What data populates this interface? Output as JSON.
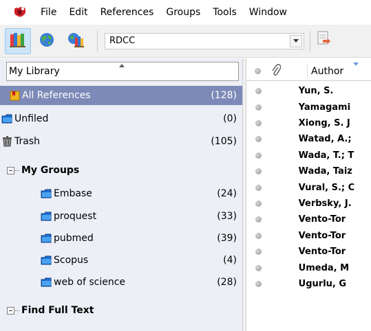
{
  "menubar": {
    "logo_icon": "endnote-logo-icon",
    "items": [
      "File",
      "Edit",
      "References",
      "Groups",
      "Tools",
      "Window"
    ]
  },
  "toolbar": {
    "mode_buttons": [
      {
        "icon": "local-library-mode-icon",
        "active": true
      },
      {
        "icon": "online-search-mode-icon",
        "active": false
      },
      {
        "icon": "integrated-library-mode-icon",
        "active": false
      }
    ],
    "output_style": "RDCC",
    "insert_icon": "insert-citation-icon"
  },
  "groups": {
    "header": "My Library",
    "rows": [
      {
        "label": "All References",
        "count": "(128)",
        "icon": "all-references-icon",
        "selected": true
      },
      {
        "label": "Unfiled",
        "count": "(0)",
        "icon": "folder-icon"
      },
      {
        "label": "Trash",
        "count": "(105)",
        "icon": "trash-icon"
      }
    ],
    "sets": [
      {
        "label": "My Groups",
        "expander": "collapse-icon"
      },
      {
        "label": "Find Full Text",
        "expander": "collapse-icon"
      }
    ],
    "my_groups": [
      {
        "label": "Embase",
        "count": "(24)"
      },
      {
        "label": "proquest",
        "count": "(33)"
      },
      {
        "label": "pubmed",
        "count": "(39)"
      },
      {
        "label": "Scopus",
        "count": "(4)"
      },
      {
        "label": "web of science",
        "count": "(28)"
      }
    ]
  },
  "references": {
    "header_author": "Author",
    "authors": [
      "Yun, S.",
      "Yamagami",
      "Xiong, S. J",
      "Watad, A.;",
      "Wada, T.; T",
      "Wada, Taiz",
      "Vural, S.; C",
      "Verbsky, J.",
      "Vento-Tor",
      "Vento-Tor",
      "Vento-Tor",
      "Umeda, M",
      "Ugurlu, G"
    ]
  },
  "colors": {
    "selected_row": "#7d8ab8",
    "groups_bg": "#edeff6",
    "toolbar_bg": "#f1f1f1"
  }
}
